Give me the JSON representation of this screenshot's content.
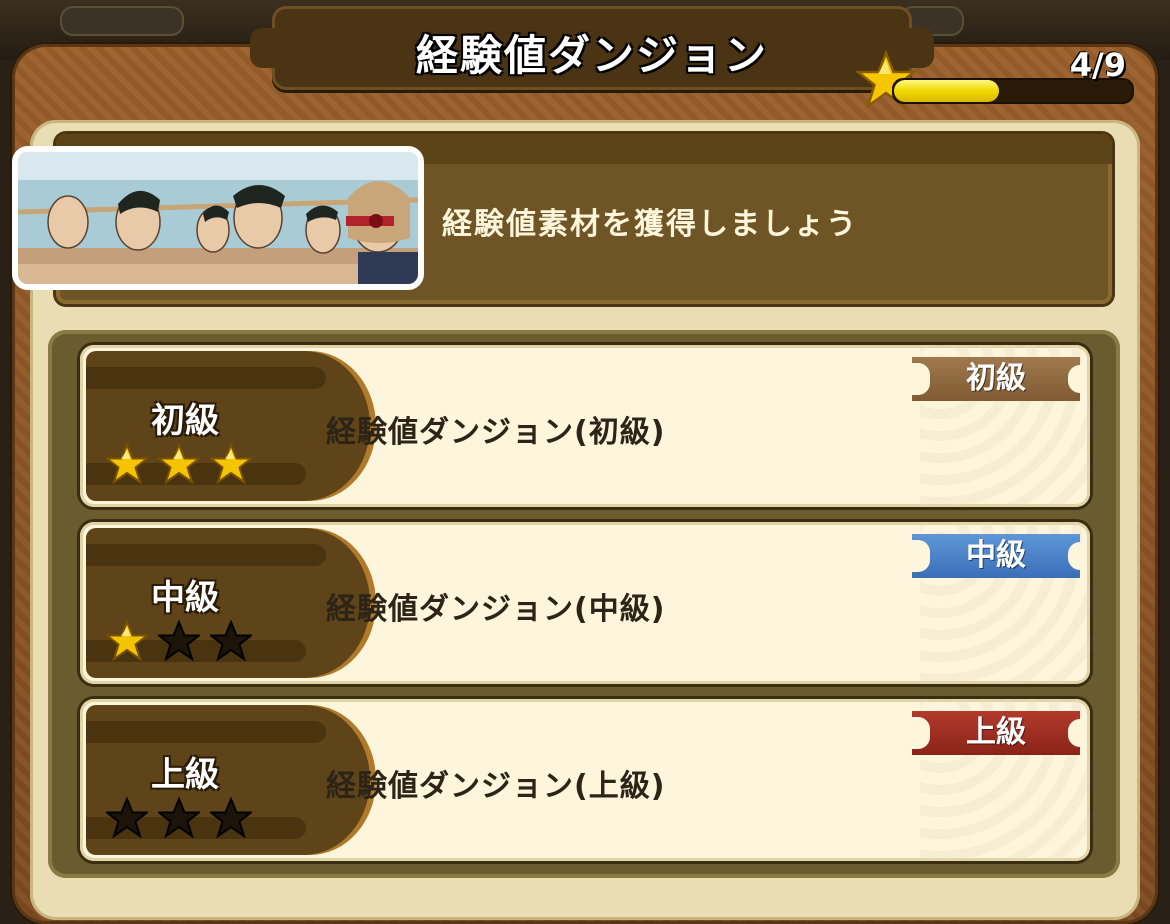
{
  "header": {
    "title": "経験値ダンジョン",
    "progress_text": "4/9",
    "progress_fraction": 0.44
  },
  "banner": {
    "message": "経験値素材を獲得しましょう"
  },
  "dungeons": [
    {
      "rank_label": "初級",
      "name": "経験値ダンジョン(初級)",
      "tag": "初級",
      "stars_filled": 3,
      "stars_total": 3
    },
    {
      "rank_label": "中級",
      "name": "経験値ダンジョン(中級)",
      "tag": "中級",
      "stars_filled": 1,
      "stars_total": 3
    },
    {
      "rank_label": "上級",
      "name": "経験値ダンジョン(上級)",
      "tag": "上級",
      "stars_filled": 0,
      "stars_total": 3
    }
  ],
  "colors": {
    "frame": "#8a5425",
    "star_gold": "#f5c400",
    "tag_beginner": "#8e6a40",
    "tag_intermediate": "#4a82cc",
    "tag_advanced": "#a0301f"
  },
  "icons": {
    "progress": "star-icon",
    "rank_star_filled": "gold-star-icon",
    "rank_star_empty": "dark-star-icon"
  }
}
